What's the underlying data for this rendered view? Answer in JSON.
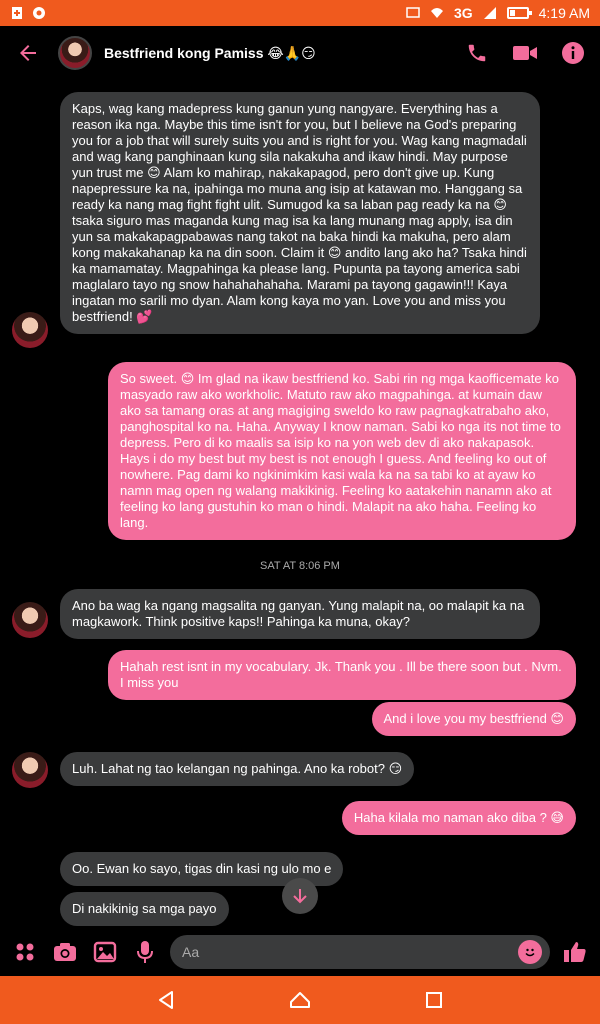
{
  "status_bar": {
    "network": "3G",
    "time": "4:19 AM"
  },
  "header": {
    "title": "Bestfriend kong Pamiss 😂🙏😏"
  },
  "messages": [
    {
      "dir": "in",
      "text": "Kaps, wag kang madepress kung ganun yung nangyare. Everything has a reason ika nga. Maybe this time isn't for you, but I believe na God's preparing you for a job that will surely suits you and is right for you. Wag kang magmadali and wag kang panghinaan kung sila nakakuha and ikaw hindi. May purpose yun trust me 😊 Alam ko mahirap, nakakapagod, pero don't give up. Kung napepressure ka na, ipahinga mo muna ang isip at katawan mo. Hanggang sa ready ka nang mag fight fight ulit. Sumugod ka sa laban pag ready ka na 😊 tsaka siguro mas maganda kung mag isa ka lang munang mag apply, isa din yun sa makakapagpabawas nang takot na baka hindi ka makuha, pero alam kong makakahanap ka na din soon. Claim it 😊 andito lang ako ha? Tsaka hindi ka mamamatay. Magpahinga ka please lang. Pupunta pa tayong america sabi maglalaro tayo ng snow hahahahahaha. Marami pa tayong gagawin!!! Kaya ingatan mo sarili mo dyan. Alam kong kaya mo yan. Love you and miss you bestfriend! 💕"
    },
    {
      "dir": "out",
      "text": "So sweet. 😊 Im glad na ikaw bestfriend ko. Sabi rin ng mga kaofficemate ko masyado raw ako workholic. Matuto raw ako magpahinga. at kumain daw ako sa tamang oras at ang magiging sweldo ko raw pagnagkatrabaho ako, panghospital ko na. Haha. Anyway I know naman. Sabi ko nga its not time to depress. Pero di ko maalis sa isip ko na yon web dev di ako nakapasok. Hays i do my best but my best is not enough I guess. And feeling ko out of nowhere. Pag dami ko ngkinimkim kasi wala ka na sa tabi ko at ayaw ko namn mag open ng walang makikinig. Feeling ko aatakehin nanamn ako at feeling ko lang gustuhin ko man o hindi. Malapit na ako haha. Feeling ko lang."
    },
    {
      "dir": "in",
      "text": "Ano ba wag ka ngang magsalita ng ganyan. Yung malapit na, oo malapit ka na magkawork. Think positive kaps!! Pahinga ka muna, okay?"
    },
    {
      "dir": "out",
      "text": "Hahah rest isnt in my vocabulary. Jk. Thank you . Ill be there soon but . Nvm. I miss you"
    },
    {
      "dir": "out",
      "text": "And i love you my bestfriend 😊"
    },
    {
      "dir": "in",
      "text": "Luh. Lahat ng tao kelangan ng pahinga. Ano ka robot? 😏"
    },
    {
      "dir": "out",
      "text": "Haha kilala mo naman ako diba ? 😅"
    },
    {
      "dir": "in",
      "text": "Oo. Ewan ko sayo, tigas din kasi ng ulo mo e"
    },
    {
      "dir": "in",
      "text": "Di nakikinig sa mga payo"
    }
  ],
  "timestamp": "SAT AT 8:06 PM",
  "composer": {
    "placeholder": "Aa"
  },
  "colors": {
    "accent": "#f36d9c",
    "bar": "#f05a1e",
    "incoming": "#3a3b3c"
  }
}
